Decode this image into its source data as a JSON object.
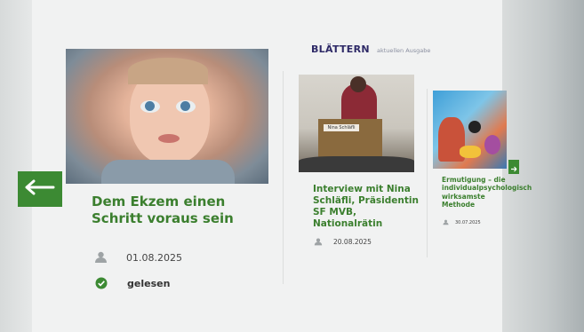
{
  "header": {
    "brand": "BLÄTTERN",
    "subtitle": "aktuellen Ausgabe"
  },
  "cards": [
    {
      "title": "Dem Ekzem einen Schritt voraus sein",
      "date": "01.08.2025",
      "status": "gelesen",
      "image_icon": "baby-photo"
    },
    {
      "title": "Interview mit Nina Schläfli, Präsidentin SF MVB, Nationalrätin",
      "date": "20.08.2025",
      "image_icon": "speaker-photo",
      "lectern_label": "Nina Schläfli"
    },
    {
      "title": "Ermutigung – die individualpsychologisch wirksamste Methode",
      "date": "30.07.2025",
      "image_icon": "illustration"
    }
  ],
  "navigation": {
    "prev_icon": "arrow-left-icon",
    "next_icon": "arrow-right-icon"
  },
  "colors": {
    "accent_green": "#3c8a33",
    "brand_navy": "#2e2a67"
  }
}
